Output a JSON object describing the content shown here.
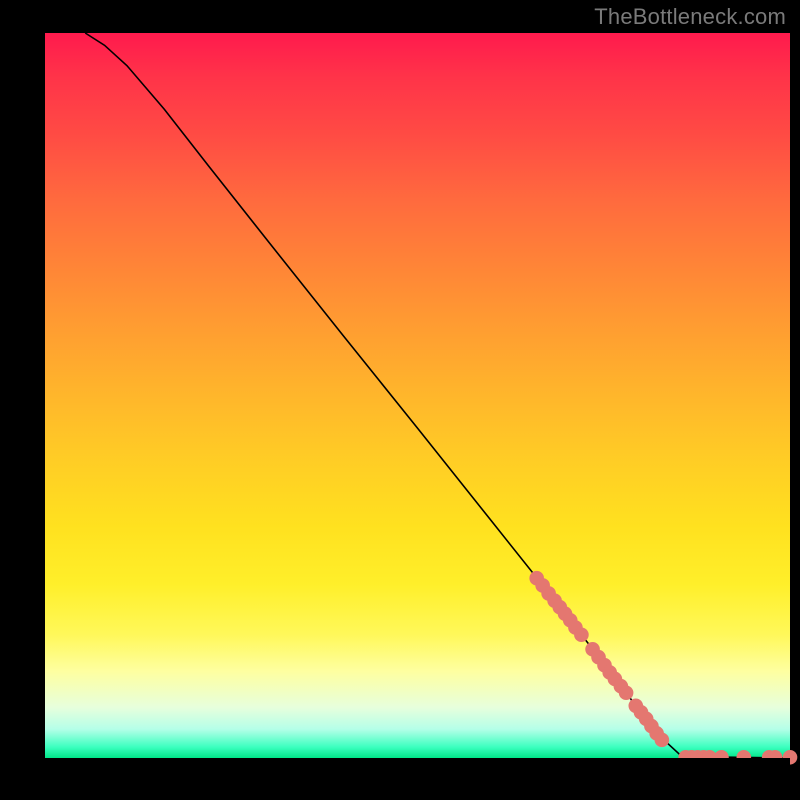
{
  "watermark_text": "TheBottleneck.com",
  "chart_data": {
    "type": "line",
    "title": "",
    "xlabel": "",
    "ylabel": "",
    "xlim": [
      0,
      100
    ],
    "ylim": [
      0,
      100
    ],
    "grid": false,
    "legend": null,
    "curve": [
      {
        "x": 5.4,
        "y": 100.0
      },
      {
        "x": 8.0,
        "y": 98.3
      },
      {
        "x": 11.0,
        "y": 95.5
      },
      {
        "x": 16.0,
        "y": 89.5
      },
      {
        "x": 22.0,
        "y": 81.6
      },
      {
        "x": 30.0,
        "y": 71.2
      },
      {
        "x": 40.0,
        "y": 58.3
      },
      {
        "x": 50.0,
        "y": 45.5
      },
      {
        "x": 60.0,
        "y": 32.6
      },
      {
        "x": 70.0,
        "y": 19.7
      },
      {
        "x": 78.0,
        "y": 9.0
      },
      {
        "x": 82.0,
        "y": 3.5
      },
      {
        "x": 85.5,
        "y": 0.2
      },
      {
        "x": 100.0,
        "y": 0.0
      }
    ],
    "markers": [
      {
        "x": 66.0,
        "y": 24.8
      },
      {
        "x": 66.8,
        "y": 23.8
      },
      {
        "x": 67.6,
        "y": 22.7
      },
      {
        "x": 68.4,
        "y": 21.7
      },
      {
        "x": 69.1,
        "y": 20.8
      },
      {
        "x": 69.8,
        "y": 19.9
      },
      {
        "x": 70.5,
        "y": 19.0
      },
      {
        "x": 71.2,
        "y": 18.0
      },
      {
        "x": 72.0,
        "y": 17.0
      },
      {
        "x": 73.5,
        "y": 15.0
      },
      {
        "x": 74.3,
        "y": 13.9
      },
      {
        "x": 75.1,
        "y": 12.8
      },
      {
        "x": 75.8,
        "y": 11.8
      },
      {
        "x": 76.5,
        "y": 10.9
      },
      {
        "x": 77.3,
        "y": 9.9
      },
      {
        "x": 78.0,
        "y": 9.0
      },
      {
        "x": 79.3,
        "y": 7.2
      },
      {
        "x": 80.0,
        "y": 6.3
      },
      {
        "x": 80.7,
        "y": 5.4
      },
      {
        "x": 81.4,
        "y": 4.4
      },
      {
        "x": 82.1,
        "y": 3.4
      },
      {
        "x": 82.8,
        "y": 2.5
      },
      {
        "x": 86.0,
        "y": 0.1
      },
      {
        "x": 86.8,
        "y": 0.1
      },
      {
        "x": 87.6,
        "y": 0.1
      },
      {
        "x": 88.4,
        "y": 0.1
      },
      {
        "x": 89.2,
        "y": 0.1
      },
      {
        "x": 90.8,
        "y": 0.1
      },
      {
        "x": 93.8,
        "y": 0.1
      },
      {
        "x": 97.2,
        "y": 0.1
      },
      {
        "x": 98.0,
        "y": 0.1
      },
      {
        "x": 100.0,
        "y": 0.1
      }
    ],
    "marker_color": "#e47770",
    "curve_color": "#000000"
  }
}
